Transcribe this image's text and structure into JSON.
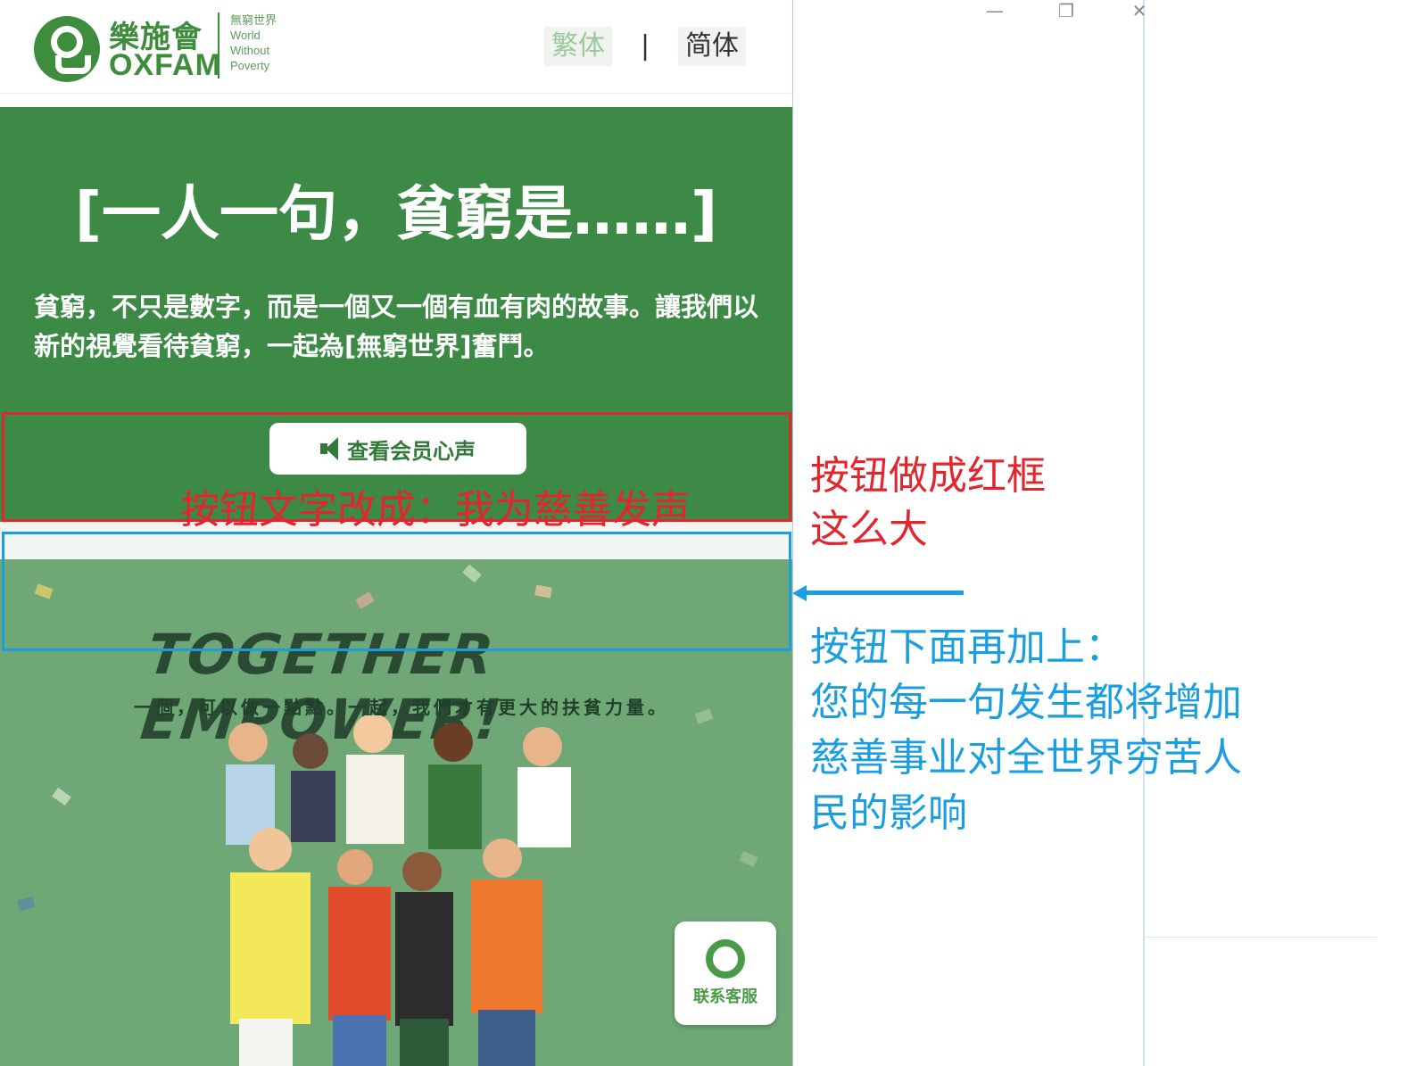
{
  "header": {
    "logo_cn": "樂施會",
    "logo_en": "OXFAM",
    "logo_tagline": [
      "無窮世界",
      "World",
      "Without",
      "Poverty"
    ],
    "lang_traditional": "繁体",
    "lang_separator": "|",
    "lang_simplified": "简体"
  },
  "hero": {
    "title": "[一人一句，貧窮是……]",
    "description": "貧窮，不只是數字，而是一個又一個有血有肉的故事。讓我們以新的視覺看待貧窮，一起為[無窮世界]奮鬥。",
    "member_button": "查看会员心声"
  },
  "poster": {
    "title": "TOGETHER EMPOWER!",
    "subtitle": "一個，可以做一點點。一起，我們才有更大的扶貧力量。"
  },
  "service_button": {
    "label": "联系客服"
  },
  "annotations": {
    "button_text_note": "按钮文字改成：我为慈善发声",
    "button_size_note": [
      "按钮做成红框",
      "这么大"
    ],
    "add_below_note": [
      "按钮下面再加上：",
      "您的每一句发生都将增加",
      "慈善事业对全世界穷苦人",
      "民的影响"
    ]
  },
  "window_controls": {
    "minimize": "—",
    "restore": "❐",
    "close": "✕"
  },
  "colors": {
    "brand_green": "#3c8a45",
    "annotation_red": "#e1262d",
    "annotation_blue": "#1a9ee0",
    "poster_green": "#6fa777"
  }
}
